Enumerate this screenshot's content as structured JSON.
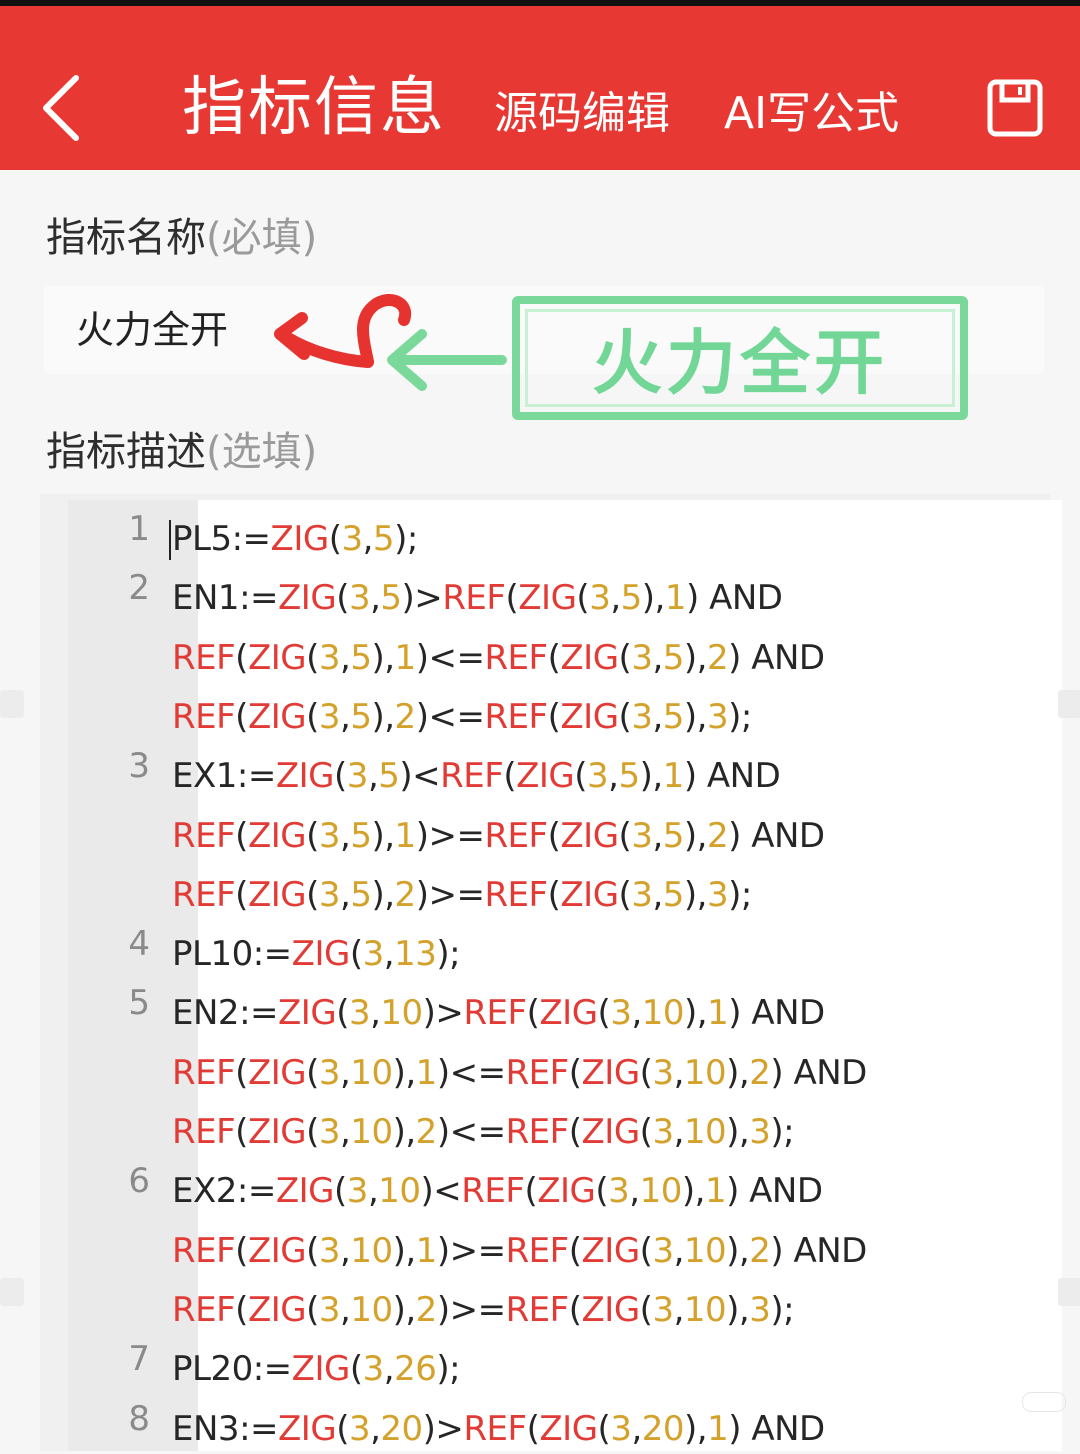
{
  "header": {
    "title": "指标信息",
    "nav_source_edit": "源码编辑",
    "nav_ai_formula": "AI写公式",
    "back_icon": "chevron-left-icon",
    "save_icon": "save-icon",
    "bg_color": "#e73833"
  },
  "form": {
    "name_label": "指标名称",
    "name_hint": "(必填)",
    "name_value": "火力全开",
    "desc_label": "指标描述",
    "desc_hint": "(选填)"
  },
  "annotation": {
    "callout_text": "火力全开",
    "callout_color": "#72d697",
    "arrow_color": "#e7332f"
  },
  "editor": {
    "lines": [
      {
        "no": "1",
        "rows": [
          "PL5:=ZIG(3,5);"
        ]
      },
      {
        "no": "2",
        "rows": [
          "EN1:=ZIG(3,5)>REF(ZIG(3,5),1) AND",
          "REF(ZIG(3,5),1)<=REF(ZIG(3,5),2) AND",
          "REF(ZIG(3,5),2)<=REF(ZIG(3,5),3);"
        ]
      },
      {
        "no": "3",
        "rows": [
          "EX1:=ZIG(3,5)<REF(ZIG(3,5),1) AND",
          "REF(ZIG(3,5),1)>=REF(ZIG(3,5),2) AND",
          "REF(ZIG(3,5),2)>=REF(ZIG(3,5),3);"
        ]
      },
      {
        "no": "4",
        "rows": [
          "PL10:=ZIG(3,13);"
        ]
      },
      {
        "no": "5",
        "rows": [
          "EN2:=ZIG(3,10)>REF(ZIG(3,10),1) AND",
          "REF(ZIG(3,10),1)<=REF(ZIG(3,10),2) AND",
          "REF(ZIG(3,10),2)<=REF(ZIG(3,10),3);"
        ]
      },
      {
        "no": "6",
        "rows": [
          "EX2:=ZIG(3,10)<REF(ZIG(3,10),1) AND",
          "REF(ZIG(3,10),1)>=REF(ZIG(3,10),2) AND",
          "REF(ZIG(3,10),2)>=REF(ZIG(3,10),3);"
        ]
      },
      {
        "no": "7",
        "rows": [
          "PL20:=ZIG(3,26);"
        ]
      },
      {
        "no": "8",
        "rows": [
          "EN3:=ZIG(3,20)>REF(ZIG(3,20),1) AND"
        ]
      }
    ],
    "colors": {
      "function": "#e23a35",
      "number": "#d4a12a",
      "text": "#262626"
    }
  }
}
